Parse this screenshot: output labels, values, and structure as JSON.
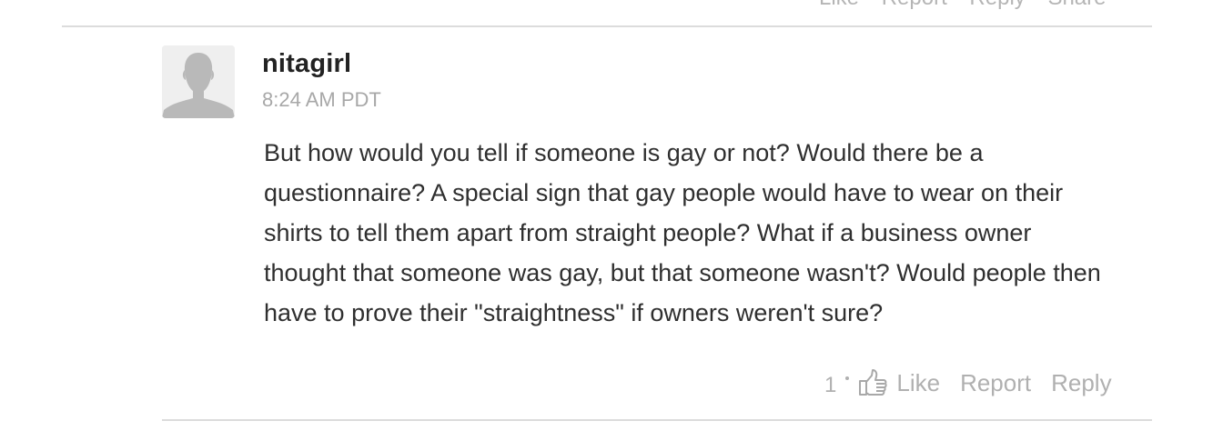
{
  "previous_comment": {
    "actions": [
      "Like",
      "Report",
      "Reply",
      "Share"
    ]
  },
  "comment": {
    "author": "nitagirl",
    "timestamp": "8:24 AM PDT",
    "avatar_icon": "default-user-avatar-icon",
    "lines": [
      "But how would you tell if someone is gay or not? Would there be a",
      "questionnaire? A special sign that gay people would have to wear on their",
      "shirts to tell them apart from straight people? What if a business owner",
      "thought that someone was gay, but that someone wasn't? Would people then",
      "have to prove their \"straightness\" if owners weren't sure?"
    ],
    "like_count": "1",
    "actions": {
      "like": "Like",
      "report": "Report",
      "reply": "Reply"
    }
  },
  "colors": {
    "divider": "#dcdcdc",
    "muted_text": "#b0b0b0",
    "body_text": "#2f2f2f"
  }
}
